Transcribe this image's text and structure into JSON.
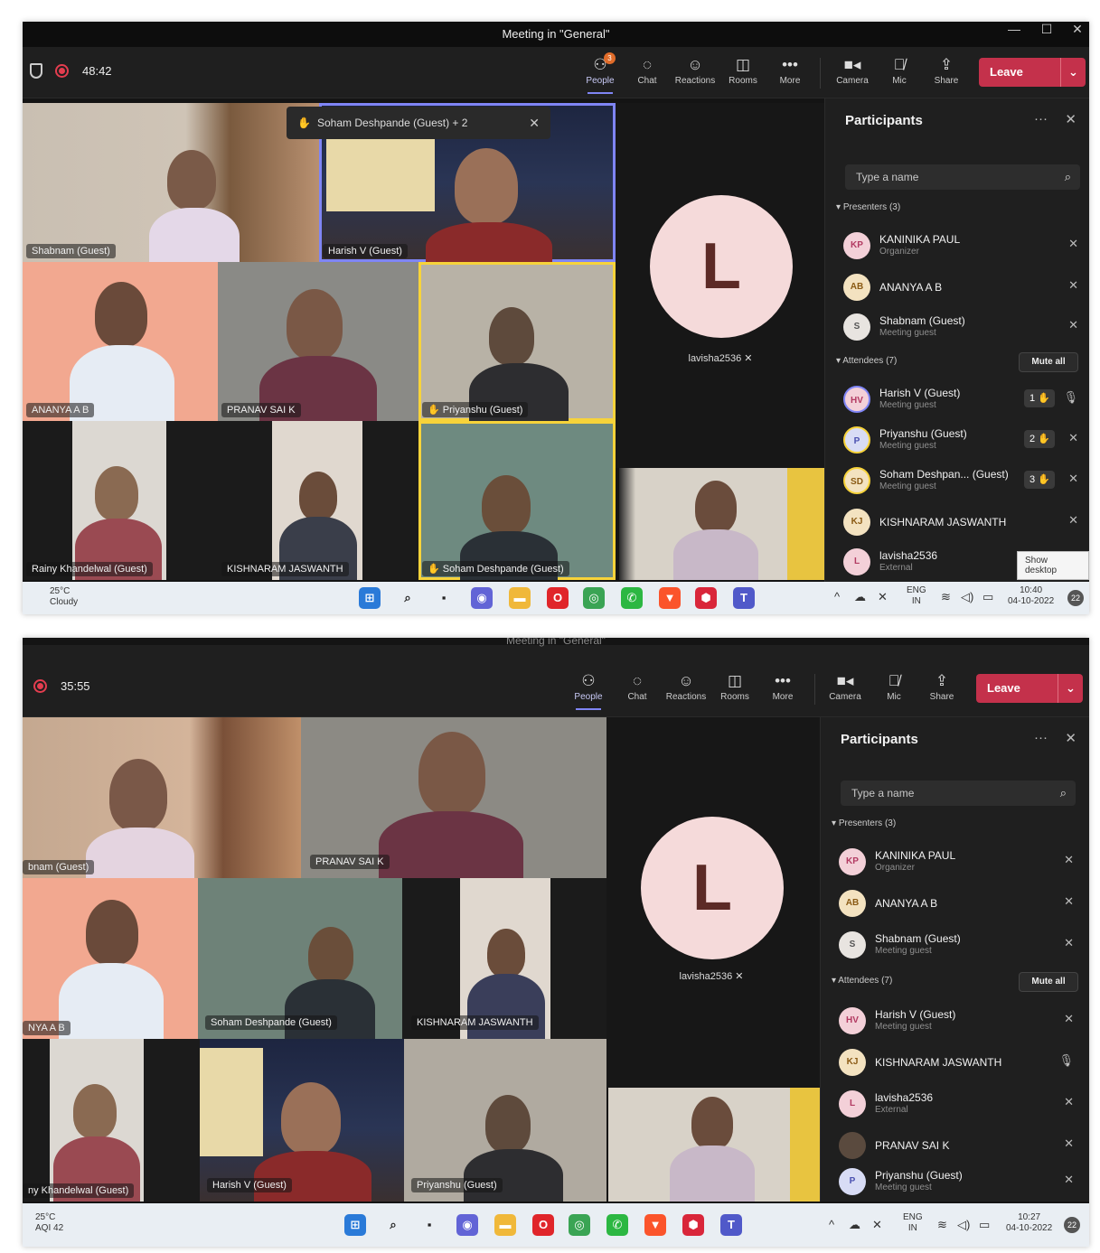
{
  "screenshot1": {
    "window_title": "Meeting in \"General\"",
    "timer": "48:42",
    "toolbar": {
      "people": "People",
      "people_badge": "3",
      "chat": "Chat",
      "reactions": "Reactions",
      "rooms": "Rooms",
      "more": "More",
      "camera": "Camera",
      "mic": "Mic",
      "share": "Share",
      "leave": "Leave"
    },
    "raised_hands": "Soham Deshpande (Guest) + 2",
    "tiles": {
      "shabnam": "Shabnam (Guest)",
      "harish": "Harish V (Guest)",
      "ananya": "ANANYA A B",
      "pranav": "PRANAV SAI K",
      "priyanshu": "Priyanshu (Guest)",
      "rainy": "Rainy Khandelwal (Guest)",
      "kishnaram": "KISHNARAM JASWANTH",
      "soham": "Soham Deshpande (Guest)"
    },
    "avatar_letter": "L",
    "avatar_name": "lavisha2536",
    "panel": {
      "title": "Participants",
      "search_placeholder": "Type a name",
      "presenters_label": "Presenters (3)",
      "attendees_label": "Attendees (7)",
      "mute_all": "Mute all",
      "presenters": [
        {
          "initials": "KP",
          "name": "KANINIKA PAUL",
          "role": "Organizer"
        },
        {
          "initials": "AB",
          "name": "ANANYA A B",
          "role": ""
        },
        {
          "initials": "S",
          "name": "Shabnam (Guest)",
          "role": "Meeting guest"
        }
      ],
      "attendees": [
        {
          "initials": "HV",
          "name": "Harish V (Guest)",
          "role": "Meeting guest",
          "hand": "1"
        },
        {
          "initials": "P",
          "name": "Priyanshu (Guest)",
          "role": "Meeting guest",
          "hand": "2"
        },
        {
          "initials": "SD",
          "name": "Soham Deshpan... (Guest)",
          "role": "Meeting guest",
          "hand": "3"
        },
        {
          "initials": "KJ",
          "name": "KISHNARAM JASWANTH",
          "role": ""
        },
        {
          "initials": "L",
          "name": "lavisha2536",
          "role": "External"
        }
      ],
      "show_desktop": "Show desktop"
    },
    "taskbar": {
      "temp": "25°C",
      "weather": "Cloudy",
      "lang1": "ENG",
      "lang2": "IN",
      "time": "10:40",
      "date": "04-10-2022",
      "notif": "22"
    }
  },
  "screenshot2": {
    "window_title": "Meeting in \"General\"",
    "timer": "35:55",
    "toolbar": {
      "people": "People",
      "chat": "Chat",
      "reactions": "Reactions",
      "rooms": "Rooms",
      "more": "More",
      "camera": "Camera",
      "mic": "Mic",
      "share": "Share",
      "leave": "Leave"
    },
    "tiles": {
      "shabnam": "bnam (Guest)",
      "pranav": "PRANAV SAI K",
      "ananya": "NYA A B",
      "soham": "Soham Deshpande (Guest)",
      "kishnaram": "KISHNARAM JASWANTH",
      "rainy": "ny Khandelwal (Guest)",
      "harish": "Harish V (Guest)",
      "priyanshu": "Priyanshu (Guest)"
    },
    "avatar_letter": "L",
    "avatar_name": "lavisha2536",
    "panel": {
      "title": "Participants",
      "search_placeholder": "Type a name",
      "presenters_label": "Presenters (3)",
      "attendees_label": "Attendees (7)",
      "mute_all": "Mute all",
      "presenters": [
        {
          "initials": "KP",
          "name": "KANINIKA PAUL",
          "role": "Organizer"
        },
        {
          "initials": "AB",
          "name": "ANANYA A B",
          "role": ""
        },
        {
          "initials": "S",
          "name": "Shabnam (Guest)",
          "role": "Meeting guest"
        }
      ],
      "attendees": [
        {
          "initials": "HV",
          "name": "Harish V (Guest)",
          "role": "Meeting guest"
        },
        {
          "initials": "KJ",
          "name": "KISHNARAM JASWANTH",
          "role": ""
        },
        {
          "initials": "L",
          "name": "lavisha2536",
          "role": "External"
        },
        {
          "initials": "",
          "name": "PRANAV SAI K",
          "role": ""
        },
        {
          "initials": "P",
          "name": "Priyanshu (Guest)",
          "role": "Meeting guest"
        }
      ]
    },
    "taskbar": {
      "temp": "25°C",
      "weather": "AQI 42",
      "lang1": "ENG",
      "lang2": "IN",
      "time": "10:27",
      "date": "04-10-2022",
      "notif": "22"
    }
  }
}
